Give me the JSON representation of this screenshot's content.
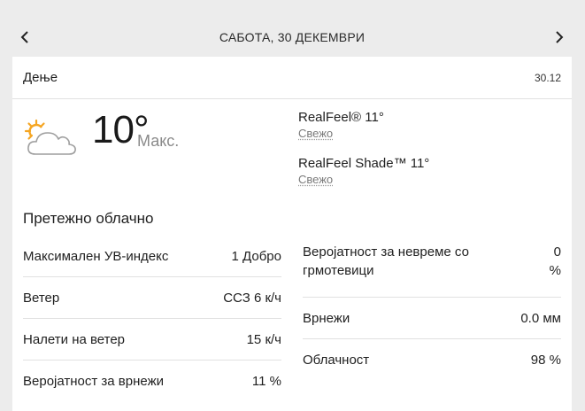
{
  "header": {
    "title": "САБОТА, 30 ДЕКЕМВРИ",
    "prev_icon": "chevron-left-icon",
    "next_icon": "chevron-right-icon"
  },
  "period": {
    "name": "Дење",
    "date": "30.12"
  },
  "current": {
    "icon": "partly-cloudy-icon",
    "temperature": "10°",
    "temp_label": "Макс.",
    "realfeel_label": "RealFeel® 11°",
    "realfeel_desc": "Свежо",
    "realfeel_shade_label": "RealFeel Shade™ 11°",
    "realfeel_shade_desc": "Свежо",
    "phrase": "Претежно облачно"
  },
  "details_left": [
    {
      "label": "Максимален УВ-индекс",
      "value": "1 Добро"
    },
    {
      "label": "Ветер",
      "value": "ССЗ 6 к/ч"
    },
    {
      "label": "Налети на ветер",
      "value": "15 к/ч"
    },
    {
      "label": "Веројатност за врнежи",
      "value": "11 %"
    }
  ],
  "details_right": [
    {
      "label": "Веројатност за невреме со грмотевици",
      "value_line1": "0",
      "value_line2": "%"
    },
    {
      "label": "Врнежи",
      "value": "0.0 мм"
    },
    {
      "label": "Облачност",
      "value": "98 %"
    }
  ],
  "colors": {
    "sun": "#f5a623",
    "cloud_stroke": "#9e9e9e",
    "background": "#ececec"
  }
}
